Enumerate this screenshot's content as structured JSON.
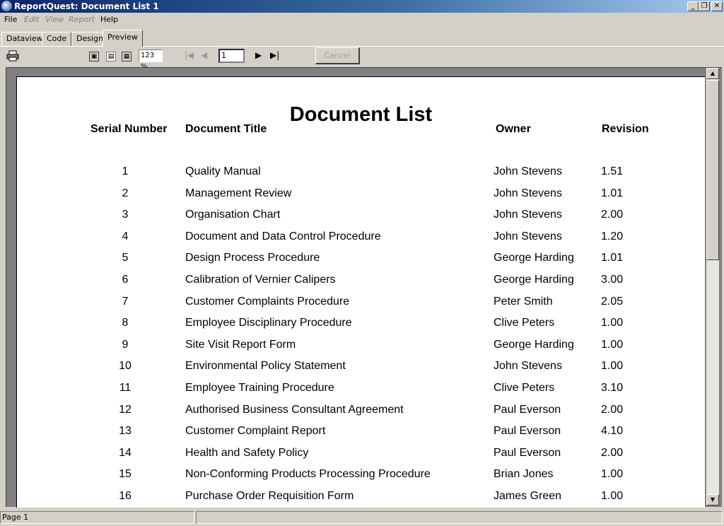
{
  "window": {
    "title": "ReportQuest: Document List 1",
    "controls": {
      "minimize": "_",
      "restore": "❐",
      "close": "✕"
    }
  },
  "menu": [
    "File",
    "Edit",
    "View",
    "Report",
    "Help"
  ],
  "tabs": [
    "Dataview",
    "Code",
    "Design",
    "Preview"
  ],
  "active_tab": "Preview",
  "toolbar": {
    "zoom": "123 %",
    "page_number": "1",
    "cancel_label": "Cancel"
  },
  "report": {
    "title": "Document List",
    "columns": [
      "Serial Number",
      "Document Title",
      "Owner",
      "Revision"
    ],
    "rows": [
      {
        "serial": "1",
        "title": "Quality Manual",
        "owner": "John Stevens",
        "revision": "1.51"
      },
      {
        "serial": "2",
        "title": "Management Review",
        "owner": "John Stevens",
        "revision": "1.01"
      },
      {
        "serial": "3",
        "title": "Organisation Chart",
        "owner": "John Stevens",
        "revision": "2.00"
      },
      {
        "serial": "4",
        "title": "Document and Data Control Procedure",
        "owner": "John Stevens",
        "revision": "1.20"
      },
      {
        "serial": "5",
        "title": "Design Process Procedure",
        "owner": "George Harding",
        "revision": "1.01"
      },
      {
        "serial": "6",
        "title": "Calibration of Vernier Calipers",
        "owner": "George Harding",
        "revision": "3.00"
      },
      {
        "serial": "7",
        "title": "Customer Complaints Procedure",
        "owner": "Peter Smith",
        "revision": "2.05"
      },
      {
        "serial": "8",
        "title": "Employee Disciplinary Procedure",
        "owner": "Clive Peters",
        "revision": "1.00"
      },
      {
        "serial": "9",
        "title": "Site Visit Report Form",
        "owner": "George Harding",
        "revision": "1.00"
      },
      {
        "serial": "10",
        "title": "Environmental Policy Statement",
        "owner": "John Stevens",
        "revision": "1.00"
      },
      {
        "serial": "11",
        "title": "Employee Training Procedure",
        "owner": "Clive Peters",
        "revision": "3.10"
      },
      {
        "serial": "12",
        "title": "Authorised Business Consultant Agreement",
        "owner": "Paul Everson",
        "revision": "2.00"
      },
      {
        "serial": "13",
        "title": "Customer Complaint Report",
        "owner": "Paul Everson",
        "revision": "4.10"
      },
      {
        "serial": "14",
        "title": "Health and Safety Policy",
        "owner": "Paul Everson",
        "revision": "2.00"
      },
      {
        "serial": "15",
        "title": "Non-Conforming Products Processing Procedure",
        "owner": "Brian Jones",
        "revision": "1.00"
      },
      {
        "serial": "16",
        "title": "Purchase Order Requisition Form",
        "owner": "James Green",
        "revision": "1.00"
      }
    ]
  },
  "status": {
    "page": "Page 1"
  },
  "icons": [
    "print-icon",
    "single-page-icon",
    "page-width-icon",
    "multi-page-icon",
    "first-page-icon",
    "prev-page-icon",
    "next-page-icon",
    "last-page-icon"
  ]
}
